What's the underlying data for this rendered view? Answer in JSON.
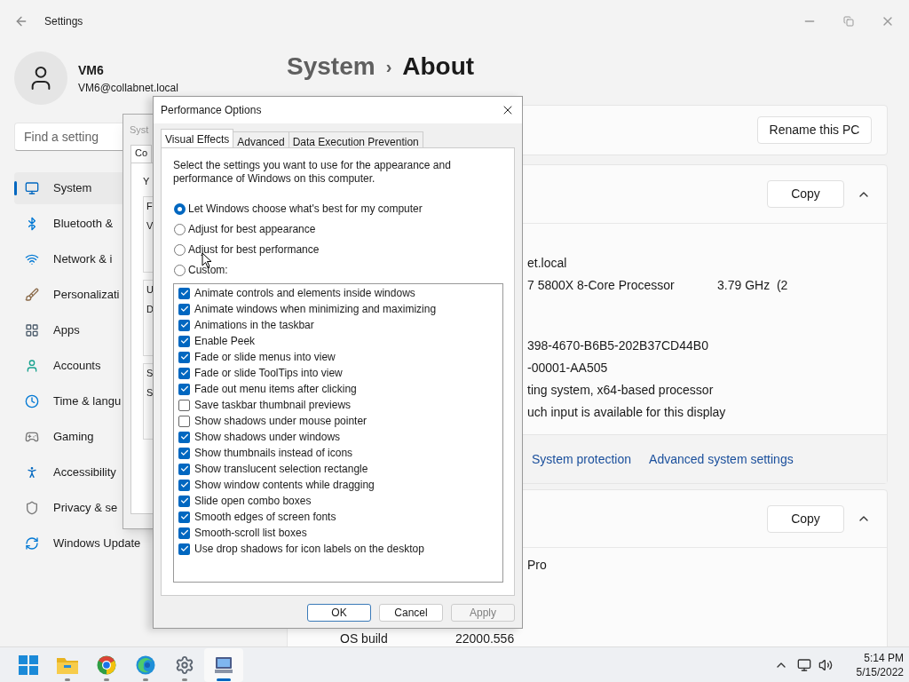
{
  "settings": {
    "title": "Settings",
    "user": {
      "name": "VM6",
      "email": "VM6@collabnet.local"
    },
    "search": {
      "placeholder": "Find a setting"
    },
    "nav": [
      {
        "label": "System",
        "selected": true
      },
      {
        "label": "Bluetooth &",
        "selected": false
      },
      {
        "label": "Network & i",
        "selected": false
      },
      {
        "label": "Personalizati",
        "selected": false
      },
      {
        "label": "Apps",
        "selected": false
      },
      {
        "label": "Accounts",
        "selected": false
      },
      {
        "label": "Time & langu",
        "selected": false
      },
      {
        "label": "Gaming",
        "selected": false
      },
      {
        "label": "Accessibility",
        "selected": false
      },
      {
        "label": "Privacy & se",
        "selected": false
      },
      {
        "label": "Windows Update",
        "selected": false
      }
    ],
    "breadcrumb": {
      "parent": "System",
      "separator": "›",
      "current": "About"
    },
    "rename_button": "Rename this PC",
    "device_card": {
      "copy_button": "Copy",
      "expanded": true,
      "rows": [
        {
          "value": "et.local"
        },
        {
          "value": "7 5800X 8-Core Processor",
          "extra": "3.79 GHz  (2"
        },
        {
          "value": "398-4670-B6B5-202B37CD44B0"
        },
        {
          "value": "-00001-AA505"
        },
        {
          "value": "ting system, x64-based processor"
        },
        {
          "value": "uch input is available for this display"
        }
      ]
    },
    "related_links": [
      "System protection",
      "Advanced system settings"
    ],
    "windows_card": {
      "copy_button": "Copy",
      "expanded": true,
      "edition_value": "Pro",
      "os_build": {
        "label": "OS build",
        "value": "22000.556"
      }
    }
  },
  "system_properties": {
    "title": "Syst",
    "tab": "Co",
    "intro": "Y",
    "groups": [
      [
        "F",
        "V"
      ],
      [
        "U",
        "D"
      ],
      [
        "S",
        "S"
      ]
    ]
  },
  "performance_options": {
    "title": "Performance Options",
    "tabs": [
      {
        "label": "Visual Effects",
        "selected": true
      },
      {
        "label": "Advanced",
        "selected": false
      },
      {
        "label": "Data Execution Prevention",
        "selected": false
      }
    ],
    "description": "Select the settings you want to use for the appearance and performance of Windows on this computer.",
    "radios": [
      {
        "label": "Let Windows choose what's best for my computer",
        "selected": true
      },
      {
        "label": "Adjust for best appearance",
        "selected": false
      },
      {
        "label": "Adjust for best performance",
        "selected": false
      },
      {
        "label": "Custom:",
        "selected": false
      }
    ],
    "effects": [
      {
        "label": "Animate controls and elements inside windows",
        "checked": true
      },
      {
        "label": "Animate windows when minimizing and maximizing",
        "checked": true
      },
      {
        "label": "Animations in the taskbar",
        "checked": true
      },
      {
        "label": "Enable Peek",
        "checked": true
      },
      {
        "label": "Fade or slide menus into view",
        "checked": true
      },
      {
        "label": "Fade or slide ToolTips into view",
        "checked": true
      },
      {
        "label": "Fade out menu items after clicking",
        "checked": true
      },
      {
        "label": "Save taskbar thumbnail previews",
        "checked": false
      },
      {
        "label": "Show shadows under mouse pointer",
        "checked": false
      },
      {
        "label": "Show shadows under windows",
        "checked": true
      },
      {
        "label": "Show thumbnails instead of icons",
        "checked": true
      },
      {
        "label": "Show translucent selection rectangle",
        "checked": true
      },
      {
        "label": "Show window contents while dragging",
        "checked": true
      },
      {
        "label": "Slide open combo boxes",
        "checked": true
      },
      {
        "label": "Smooth edges of screen fonts",
        "checked": true
      },
      {
        "label": "Smooth-scroll list boxes",
        "checked": true
      },
      {
        "label": "Use drop shadows for icon labels on the desktop",
        "checked": true
      }
    ],
    "buttons": [
      {
        "label": "OK",
        "kind": "default",
        "disabled": false
      },
      {
        "label": "Cancel",
        "kind": "normal",
        "disabled": false
      },
      {
        "label": "Apply",
        "kind": "normal",
        "disabled": true
      }
    ]
  },
  "taskbar": {
    "apps": [
      {
        "running": false,
        "selected": false
      },
      {
        "running": true,
        "selected": false
      },
      {
        "running": true,
        "selected": false
      },
      {
        "running": true,
        "selected": false
      },
      {
        "running": true,
        "selected": false
      },
      {
        "running": true,
        "selected": true
      }
    ],
    "time": "5:14 PM",
    "date": "5/15/2022"
  }
}
